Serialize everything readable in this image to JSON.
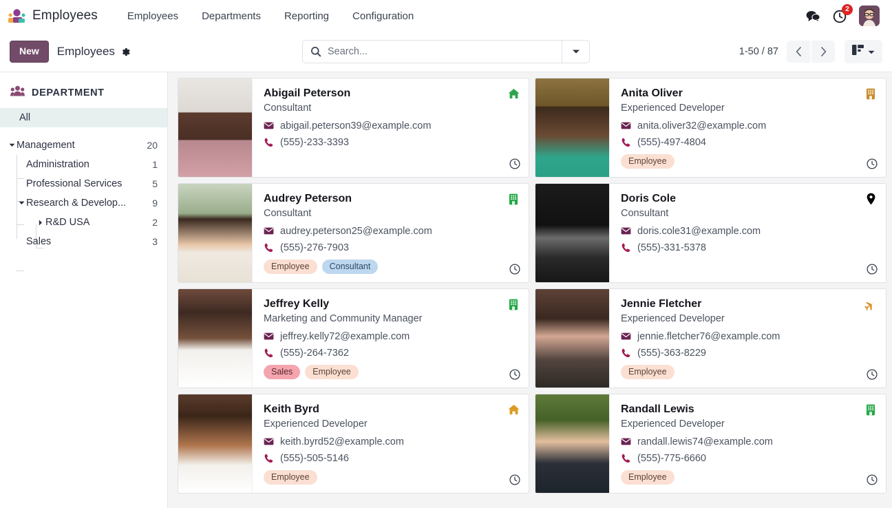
{
  "navbar": {
    "brand": "Employees",
    "menu": [
      "Employees",
      "Departments",
      "Reporting",
      "Configuration"
    ],
    "messages_icon": "chat-bubble-icon",
    "activity_icon": "clock-activity-icon",
    "activity_count": "2",
    "avatar_icon": "user-avatar"
  },
  "control_panel": {
    "new_label": "New",
    "breadcrumb_title": "Employees",
    "gear_icon": "gear-icon",
    "search": {
      "placeholder": "Search...",
      "value": "",
      "icon": "search-icon",
      "toggle_icon": "chevron-down-icon"
    },
    "pager": {
      "range": "1-50 / 87",
      "prev_icon": "chevron-left-icon",
      "next_icon": "chevron-right-icon"
    },
    "view_switcher": {
      "active_icon": "kanban-view-icon",
      "caret_icon": "caret-down-icon"
    }
  },
  "sidebar": {
    "title": "DEPARTMENT",
    "icon": "people-group-icon",
    "all_label": "All",
    "tree": [
      {
        "label": "Management",
        "count": "20",
        "level": 0,
        "caret": "down"
      },
      {
        "label": "Administration",
        "count": "1",
        "level": 1,
        "caret": "none"
      },
      {
        "label": "Professional Services",
        "count": "5",
        "level": 1,
        "caret": "none"
      },
      {
        "label": "Research & Develop...",
        "count": "9",
        "level": 1,
        "caret": "down"
      },
      {
        "label": "R&D USA",
        "count": "2",
        "level": 2,
        "caret": "right"
      },
      {
        "label": "Sales",
        "count": "3",
        "level": 1,
        "caret": "none"
      }
    ]
  },
  "kanban": {
    "cards": [
      {
        "name": "Abigail Peterson",
        "job": "Consultant",
        "email": "abigail.peterson39@example.com",
        "phone": "(555)-233-3393",
        "tags": [],
        "status_icon": "home-icon",
        "status_color": "#2ea34f",
        "clock_icon": "clock-icon",
        "photo_theme": "abigail"
      },
      {
        "name": "Anita Oliver",
        "job": "Experienced Developer",
        "email": "anita.oliver32@example.com",
        "phone": "(555)-497-4804",
        "tags": [
          {
            "label": "Employee",
            "color": "peach"
          }
        ],
        "status_icon": "building-icon",
        "status_color": "#c88a2a",
        "clock_icon": "clock-icon",
        "photo_theme": "anita"
      },
      {
        "name": "Audrey Peterson",
        "job": "Consultant",
        "email": "audrey.peterson25@example.com",
        "phone": "(555)-276-7903",
        "tags": [
          {
            "label": "Employee",
            "color": "peach"
          },
          {
            "label": "Consultant",
            "color": "blue"
          }
        ],
        "status_icon": "building-icon",
        "status_color": "#22a845",
        "clock_icon": "clock-icon",
        "photo_theme": "audrey"
      },
      {
        "name": "Doris Cole",
        "job": "Consultant",
        "email": "doris.cole31@example.com",
        "phone": "(555)-331-5378",
        "tags": [],
        "status_icon": "map-pin-icon",
        "status_color": "#2bb game",
        "clock_icon": "clock-icon",
        "photo_theme": "doris"
      },
      {
        "name": "Jeffrey Kelly",
        "job": "Marketing and Community Manager",
        "email": "jeffrey.kelly72@example.com",
        "phone": "(555)-264-7362",
        "tags": [
          {
            "label": "Sales",
            "color": "pink"
          },
          {
            "label": "Employee",
            "color": "peach"
          }
        ],
        "status_icon": "building-icon",
        "status_color": "#22a845",
        "clock_icon": "clock-icon",
        "photo_theme": "jeffrey"
      },
      {
        "name": "Jennie Fletcher",
        "job": "Experienced Developer",
        "email": "jennie.fletcher76@example.com",
        "phone": "(555)-363-8229",
        "tags": [
          {
            "label": "Employee",
            "color": "peach"
          }
        ],
        "status_icon": "airplane-icon",
        "status_color": "#d9922a",
        "clock_icon": "clock-icon",
        "photo_theme": "jennie"
      },
      {
        "name": "Keith Byrd",
        "job": "Experienced Developer",
        "email": "keith.byrd52@example.com",
        "phone": "(555)-505-5146",
        "tags": [
          {
            "label": "Employee",
            "color": "peach"
          }
        ],
        "status_icon": "home-icon",
        "status_color": "#dd9b23",
        "clock_icon": "clock-icon",
        "photo_theme": "keith"
      },
      {
        "name": "Randall Lewis",
        "job": "Experienced Developer",
        "email": "randall.lewis74@example.com",
        "phone": "(555)-775-6660",
        "tags": [
          {
            "label": "Employee",
            "color": "peach"
          }
        ],
        "status_icon": "building-icon",
        "status_color": "#22a845",
        "clock_icon": "clock-icon",
        "photo_theme": "randall"
      }
    ],
    "email_icon": "envelope-icon",
    "phone_icon": "phone-icon"
  },
  "colors": {
    "brand_purple": "#714b67",
    "badge_red": "#e02424",
    "green": "#2ea34f",
    "orange": "#d9922a",
    "selected_bg": "#e7f0ef"
  }
}
